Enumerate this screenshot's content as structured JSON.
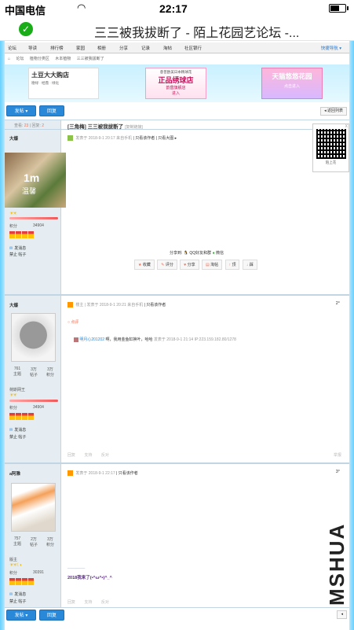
{
  "status_bar": {
    "carrier": "中国电信",
    "time": "22:17"
  },
  "browser": {
    "title": "三三被我拔断了 - 陌上花园艺论坛 -..."
  },
  "nav": {
    "items": [
      "论坛",
      "导读",
      "排行榜",
      "家园",
      "相册",
      "分享",
      "记录",
      "淘帖",
      "社区银行"
    ],
    "quick": "快捷导航"
  },
  "breadcrumb": [
    "论坛",
    "植物分类区",
    "木本植物",
    "三三被我拔断了"
  ],
  "ads": {
    "ad1": {
      "title": "土豆大大购店",
      "sub": "德绿 · 经鼎 · 绿化"
    },
    "ad2": {
      "top": "意普欧美日本精球花",
      "main": "正品绣球店",
      "sub": "韵茵旗舰店",
      "cta": "进入"
    },
    "ad3": {
      "main": "天猫悠悠花园",
      "cta": "点击进入"
    }
  },
  "toolbar": {
    "post_label": "发帖 ▾",
    "reply_label": "回复",
    "back_label": "◂ 返回列表"
  },
  "thread": {
    "views_label": "查看:",
    "views": "23",
    "replies_label": "回复:",
    "replies": "2",
    "tag": "[三角梅]",
    "title": "三三被我拔断了",
    "copy": "[复制链接]"
  },
  "qr": {
    "label": "陌上花",
    "corner": "X",
    "top": "手机版"
  },
  "posts": [
    {
      "author": "大爆",
      "info_prefix": "发表于 2018-9-1 20:17",
      "info_src": "来自手机",
      "info_links": "| 只看该作者 | 只看大图 ▸",
      "floor": "1°",
      "floor_extra": "电梯",
      "avatar_text": "1m",
      "avatar_sub": "温馨",
      "points_label": "积分",
      "points": "34904",
      "send": "发消息",
      "ban": "禁止 帖子",
      "share_label": "分享到:",
      "share_qq": "QQ好友和群",
      "share_wx": "微信",
      "actions": [
        "收藏",
        "评分",
        "分享",
        "淘帖",
        "顶",
        "踩"
      ]
    },
    {
      "author": "大爆",
      "info_prefix": "楼主",
      "info_main": "发表于 2018-9-1 20:21",
      "info_src": "来自手机",
      "info_links": "| 只看该作者",
      "floor": "2°",
      "counts": [
        {
          "v": "761",
          "k": "主题"
        },
        {
          "v": "3万",
          "k": "帖子"
        },
        {
          "v": "3万",
          "k": "积分"
        }
      ],
      "rank": "荷斯网王",
      "points_label": "积分",
      "points": "34904",
      "send": "发消息",
      "ban": "禁止 帖子",
      "reply_tag": "点评",
      "comment_who": "明月心201202",
      "comment_text": "啊，我用金鱼缸换叶，哈哈",
      "comment_meta": "发表于 2018-9-1 21:14 IP:223.159.182.80/1278",
      "foot": [
        "回复",
        "支持",
        "反对"
      ],
      "foot_right": "举报"
    },
    {
      "author": "a阿雅",
      "info_main": "发表于 2018-9-1 22:17",
      "info_links": "| 只看该作者",
      "floor": "3°",
      "counts": [
        {
          "v": "757",
          "k": "主题"
        },
        {
          "v": "2万",
          "k": "帖子"
        },
        {
          "v": "3万",
          "k": "积分"
        }
      ],
      "rank": "版主",
      "points_label": "积分",
      "points": "30391",
      "send": "发消息",
      "ban": "禁止 帖子",
      "quote": "2018我来了(•^ω^•)^_^",
      "foot": [
        "回复",
        "支持",
        "反对"
      ],
      "foot_right": "举报"
    }
  ],
  "bottom": {
    "post_label": "发帖 ▾",
    "reply_label": "回复",
    "back_label": "◂"
  },
  "watermark": "MSHUA"
}
